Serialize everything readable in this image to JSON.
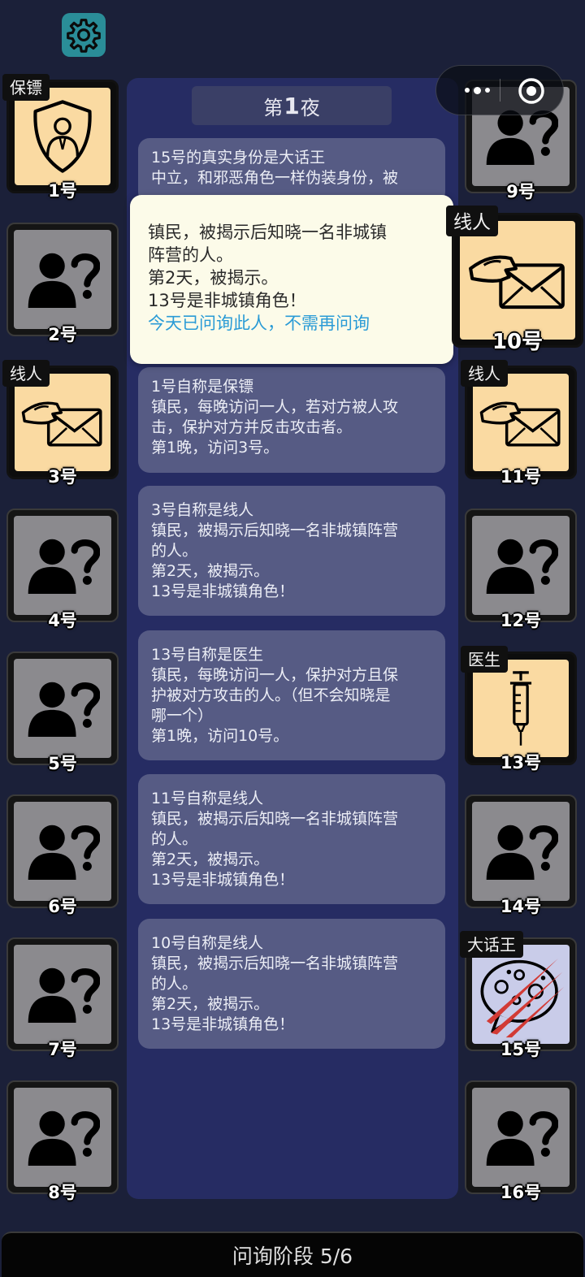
{
  "night_title": {
    "prefix": "第",
    "number": "1",
    "suffix": "夜"
  },
  "messages": [
    {
      "lines": [
        "15号的真实身份是大话王",
        "中立，和邪恶角色一样伪装身份，被"
      ]
    },
    {
      "lines": [
        "1号自称是保镖",
        "镇民，每晚访问一人，若对方被人攻",
        "击，保护对方并反击攻击者。",
        "第1晚，访问3号。"
      ]
    },
    {
      "lines": [
        "3号自称是线人",
        "镇民，被揭示后知晓一名非城镇阵营",
        "的人。",
        "第2天，被揭示。",
        "13号是非城镇角色！"
      ]
    },
    {
      "lines": [
        "13号自称是医生",
        "镇民，每晚访问一人，保护对方且保",
        "护被对方攻击的人。（但不会知晓是",
        "哪一个）",
        "第1晚，访问10号。"
      ]
    },
    {
      "lines": [
        "11号自称是线人",
        "镇民，被揭示后知晓一名非城镇阵营",
        "的人。",
        "第2天，被揭示。",
        "13号是非城镇角色！"
      ]
    },
    {
      "lines": [
        "10号自称是线人",
        "镇民，被揭示后知晓一名非城镇阵营",
        "的人。",
        "第2天，被揭示。",
        "13号是非城镇角色！"
      ]
    }
  ],
  "popup": {
    "lines": [
      "镇民，被揭示后知晓一名非城镇",
      "阵营的人。",
      "第2天，被揭示。",
      "13号是非城镇角色！"
    ],
    "notice": "今天已问询此人，不需再问询"
  },
  "players": [
    {
      "num": "1号",
      "role": "保镖",
      "icon": "bodyguard-shield-icon"
    },
    {
      "num": "2号",
      "role": "",
      "icon": "unknown-person-icon"
    },
    {
      "num": "3号",
      "role": "线人",
      "icon": "informant-envelope-icon"
    },
    {
      "num": "4号",
      "role": "",
      "icon": "unknown-person-icon"
    },
    {
      "num": "5号",
      "role": "",
      "icon": "unknown-person-icon"
    },
    {
      "num": "6号",
      "role": "",
      "icon": "unknown-person-icon"
    },
    {
      "num": "7号",
      "role": "",
      "icon": "unknown-person-icon"
    },
    {
      "num": "8号",
      "role": "",
      "icon": "unknown-person-icon"
    },
    {
      "num": "9号",
      "role": "",
      "icon": "unknown-person-icon"
    },
    {
      "num": "10号",
      "role": "线人",
      "icon": "informant-envelope-icon"
    },
    {
      "num": "11号",
      "role": "线人",
      "icon": "informant-envelope-icon"
    },
    {
      "num": "12号",
      "role": "",
      "icon": "unknown-person-icon"
    },
    {
      "num": "13号",
      "role": "医生",
      "icon": "doctor-syringe-icon"
    },
    {
      "num": "14号",
      "role": "",
      "icon": "unknown-person-icon"
    },
    {
      "num": "15号",
      "role": "大话王",
      "icon": "liar-speech-bubble-icon"
    },
    {
      "num": "16号",
      "role": "",
      "icon": "unknown-person-icon"
    }
  ],
  "phase": {
    "label": "问询阶段 5/6"
  },
  "colors": {
    "background": "#1b2039",
    "panel": "#262c63",
    "card": "#565b84",
    "role_revealed": "#fadaa2",
    "unknown": "#8b8a8e",
    "notice_blue": "#2a9bd6"
  }
}
